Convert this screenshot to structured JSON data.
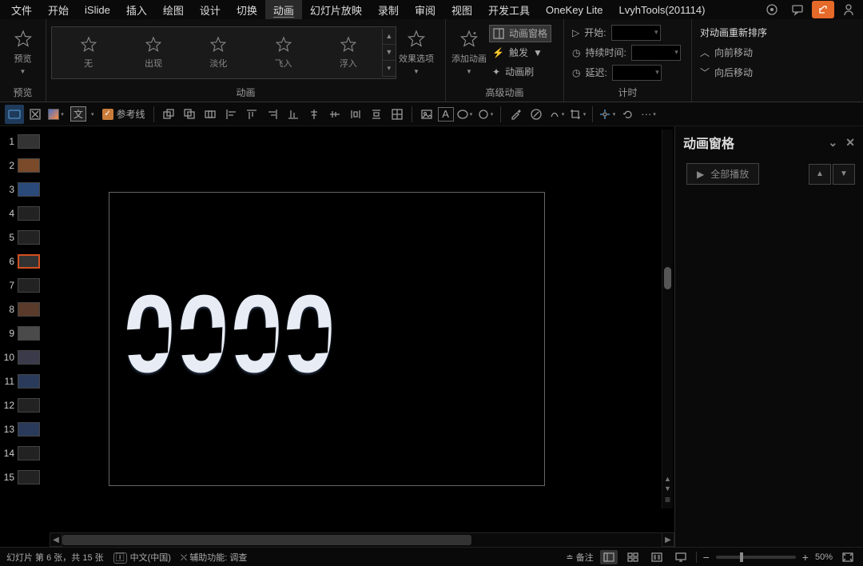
{
  "menu": {
    "items": [
      "文件",
      "开始",
      "iSlide",
      "插入",
      "绘图",
      "设计",
      "切换",
      "动画",
      "幻灯片放映",
      "录制",
      "审阅",
      "视图",
      "开发工具",
      "OneKey Lite"
    ],
    "active_index": 7,
    "lvyh": "LvyhTools(201114)"
  },
  "ribbon": {
    "preview": "预览",
    "preview_group": "预览",
    "animation_group": "动画",
    "advanced_group": "高级动画",
    "timing_group": "计时",
    "gallery": [
      {
        "label": "无"
      },
      {
        "label": "出现"
      },
      {
        "label": "淡化"
      },
      {
        "label": "飞入"
      },
      {
        "label": "浮入"
      }
    ],
    "effect_options": "效果选项",
    "add_animation": "添加动画",
    "anim_pane": "动画窗格",
    "trigger": "触发",
    "anim_painter": "动画刷",
    "start": "开始:",
    "duration": "持续时间:",
    "delay": "延迟:",
    "reorder_title": "对动画重新排序",
    "move_earlier": "向前移动",
    "move_later": "向后移动"
  },
  "quickbar": {
    "guides": "参考线",
    "textfx": "文"
  },
  "thumbs": {
    "count": 15,
    "selected": 6
  },
  "slide_content": "0000",
  "anim_pane": {
    "title": "动画窗格",
    "play_all": "全部播放"
  },
  "status": {
    "slide_of": "幻灯片 第 6 张，共 15 张",
    "lang": "中文(中国)",
    "access": "辅助功能: 调查",
    "notes": "备注",
    "zoom_pct": "50%"
  }
}
